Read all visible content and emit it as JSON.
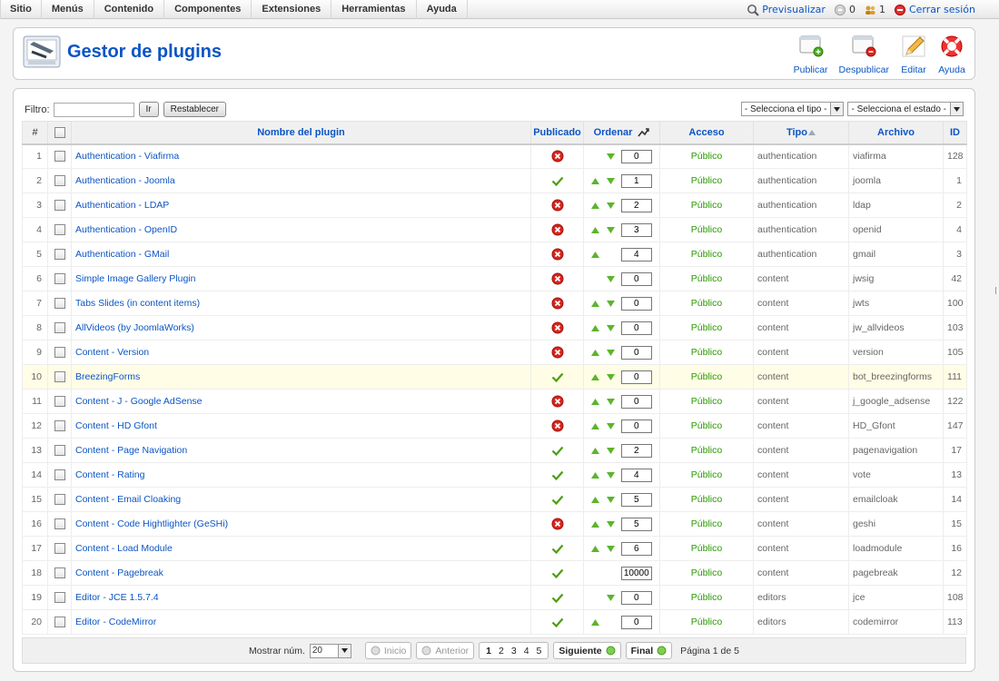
{
  "menu": [
    "Sitio",
    "Menús",
    "Contenido",
    "Componentes",
    "Extensiones",
    "Herramientas",
    "Ayuda"
  ],
  "status": {
    "preview": "Previsualizar",
    "messages": "0",
    "users": "1",
    "logout": "Cerrar sesión"
  },
  "header": {
    "title": "Gestor de plugins"
  },
  "toolbar": {
    "publish": "Publicar",
    "unpublish": "Despublicar",
    "edit": "Editar",
    "help": "Ayuda"
  },
  "filter": {
    "label": "Filtro:",
    "value": "",
    "go": "Ir",
    "reset": "Restablecer",
    "type_select": "- Selecciona el tipo -",
    "state_select": "- Selecciona el estado -"
  },
  "columns": {
    "num": "#",
    "name": "Nombre del plugin",
    "published": "Publicado",
    "order": "Ordenar",
    "access": "Acceso",
    "type": "Tipo",
    "file": "Archivo",
    "id": "ID"
  },
  "rows": [
    {
      "num": "1",
      "name": "Authentication - Viafirma",
      "published": false,
      "up": false,
      "down": true,
      "order": "0",
      "access": "Público",
      "type": "authentication",
      "file": "viafirma",
      "id": "128"
    },
    {
      "num": "2",
      "name": "Authentication - Joomla",
      "published": true,
      "up": true,
      "down": true,
      "order": "1",
      "access": "Público",
      "type": "authentication",
      "file": "joomla",
      "id": "1"
    },
    {
      "num": "3",
      "name": "Authentication - LDAP",
      "published": false,
      "up": true,
      "down": true,
      "order": "2",
      "access": "Público",
      "type": "authentication",
      "file": "ldap",
      "id": "2"
    },
    {
      "num": "4",
      "name": "Authentication - OpenID",
      "published": false,
      "up": true,
      "down": true,
      "order": "3",
      "access": "Público",
      "type": "authentication",
      "file": "openid",
      "id": "4"
    },
    {
      "num": "5",
      "name": "Authentication - GMail",
      "published": false,
      "up": true,
      "down": false,
      "order": "4",
      "access": "Público",
      "type": "authentication",
      "file": "gmail",
      "id": "3"
    },
    {
      "num": "6",
      "name": "Simple Image Gallery Plugin",
      "published": false,
      "up": false,
      "down": true,
      "order": "0",
      "access": "Público",
      "type": "content",
      "file": "jwsig",
      "id": "42"
    },
    {
      "num": "7",
      "name": "Tabs Slides (in content items)",
      "published": false,
      "up": true,
      "down": true,
      "order": "0",
      "access": "Público",
      "type": "content",
      "file": "jwts",
      "id": "100"
    },
    {
      "num": "8",
      "name": "AllVideos (by JoomlaWorks)",
      "published": false,
      "up": true,
      "down": true,
      "order": "0",
      "access": "Público",
      "type": "content",
      "file": "jw_allvideos",
      "id": "103"
    },
    {
      "num": "9",
      "name": "Content - Version",
      "published": false,
      "up": true,
      "down": true,
      "order": "0",
      "access": "Público",
      "type": "content",
      "file": "version",
      "id": "105"
    },
    {
      "num": "10",
      "name": "BreezingForms",
      "published": true,
      "up": true,
      "down": true,
      "order": "0",
      "access": "Público",
      "type": "content",
      "file": "bot_breezingforms",
      "id": "111",
      "highlight": true
    },
    {
      "num": "11",
      "name": "Content - J - Google AdSense",
      "published": false,
      "up": true,
      "down": true,
      "order": "0",
      "access": "Público",
      "type": "content",
      "file": "j_google_adsense",
      "id": "122"
    },
    {
      "num": "12",
      "name": "Content - HD Gfont",
      "published": false,
      "up": true,
      "down": true,
      "order": "0",
      "access": "Público",
      "type": "content",
      "file": "HD_Gfont",
      "id": "147"
    },
    {
      "num": "13",
      "name": "Content - Page Navigation",
      "published": true,
      "up": true,
      "down": true,
      "order": "2",
      "access": "Público",
      "type": "content",
      "file": "pagenavigation",
      "id": "17"
    },
    {
      "num": "14",
      "name": "Content - Rating",
      "published": true,
      "up": true,
      "down": true,
      "order": "4",
      "access": "Público",
      "type": "content",
      "file": "vote",
      "id": "13"
    },
    {
      "num": "15",
      "name": "Content - Email Cloaking",
      "published": true,
      "up": true,
      "down": true,
      "order": "5",
      "access": "Público",
      "type": "content",
      "file": "emailcloak",
      "id": "14"
    },
    {
      "num": "16",
      "name": "Content - Code Hightlighter (GeSHi)",
      "published": false,
      "up": true,
      "down": true,
      "order": "5",
      "access": "Público",
      "type": "content",
      "file": "geshi",
      "id": "15"
    },
    {
      "num": "17",
      "name": "Content - Load Module",
      "published": true,
      "up": true,
      "down": true,
      "order": "6",
      "access": "Público",
      "type": "content",
      "file": "loadmodule",
      "id": "16"
    },
    {
      "num": "18",
      "name": "Content - Pagebreak",
      "published": true,
      "up": false,
      "down": false,
      "order": "10000",
      "access": "Público",
      "type": "content",
      "file": "pagebreak",
      "id": "12"
    },
    {
      "num": "19",
      "name": "Editor - JCE 1.5.7.4",
      "published": true,
      "up": false,
      "down": true,
      "order": "0",
      "access": "Público",
      "type": "editors",
      "file": "jce",
      "id": "108"
    },
    {
      "num": "20",
      "name": "Editor - CodeMirror",
      "published": true,
      "up": true,
      "down": false,
      "order": "0",
      "access": "Público",
      "type": "editors",
      "file": "codemirror",
      "id": "113"
    }
  ],
  "pagination": {
    "limit_label": "Mostrar núm.",
    "limit": "20",
    "start": "Inicio",
    "prev": "Anterior",
    "pages": [
      "1",
      "2",
      "3",
      "4",
      "5"
    ],
    "current": "1",
    "next": "Siguiente",
    "end": "Final",
    "page_info": "Página 1 de 5"
  }
}
